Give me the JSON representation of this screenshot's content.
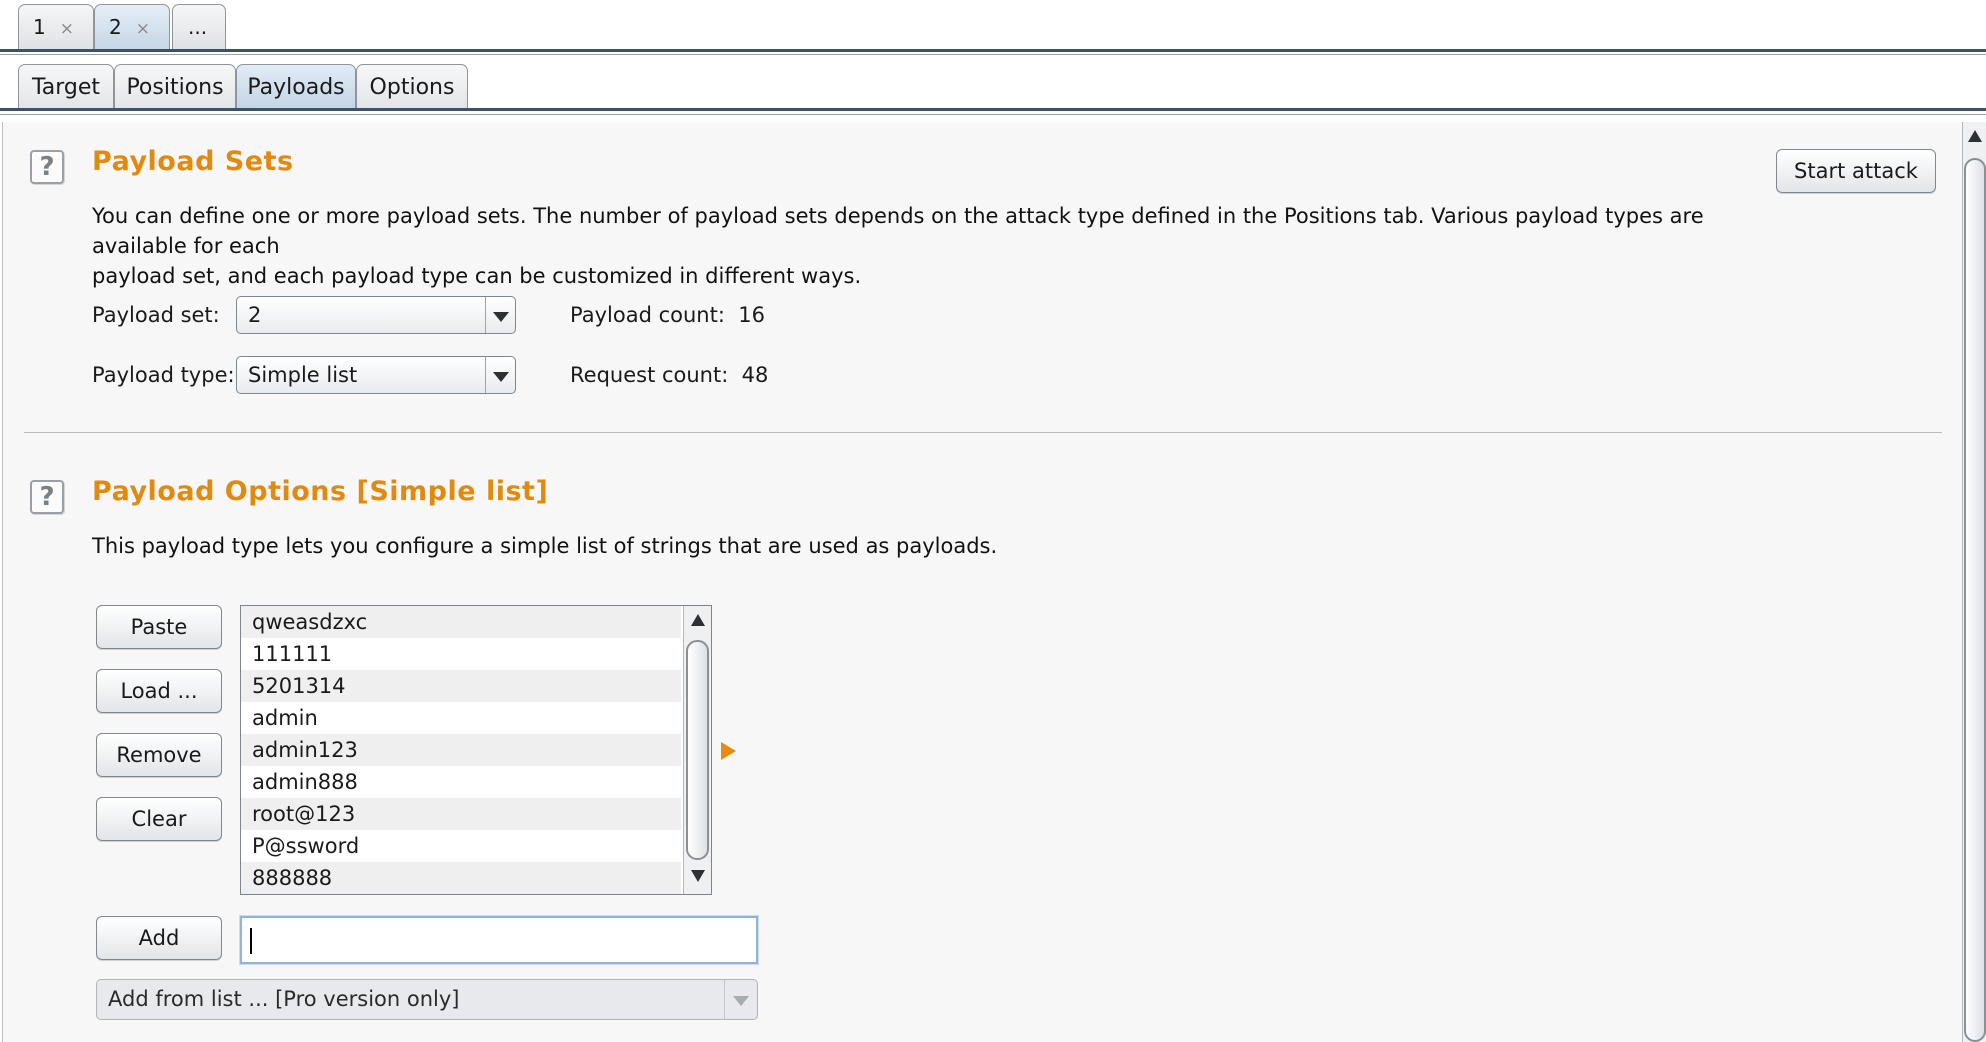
{
  "request_tabs": [
    {
      "label": "1",
      "close": "×"
    },
    {
      "label": "2",
      "close": "×"
    },
    {
      "label": "..."
    }
  ],
  "sub_tabs": [
    "Target",
    "Positions",
    "Payloads",
    "Options"
  ],
  "active_sub_tab": "Payloads",
  "payload_sets": {
    "help": "?",
    "title": "Payload Sets",
    "description_line1": "You can define one or more payload sets. The number of payload sets depends on the attack type defined in the Positions tab. Various payload types are available for each",
    "description_line2": "payload set, and each payload type can be customized in different ways.",
    "payload_set_label": "Payload set:",
    "payload_set_value": "2",
    "payload_type_label": "Payload type:",
    "payload_type_value": "Simple list",
    "payload_count_label": "Payload count:",
    "payload_count_value": "16",
    "request_count_label": "Request count:",
    "request_count_value": "48",
    "start_attack": "Start attack"
  },
  "payload_options": {
    "help": "?",
    "title": "Payload Options [Simple list]",
    "description": "This payload type lets you configure a simple list of strings that are used as payloads.",
    "buttons": {
      "paste": "Paste",
      "load": "Load ...",
      "remove": "Remove",
      "clear": "Clear",
      "add": "Add"
    },
    "list_items": [
      "qweasdzxc",
      "111111",
      "5201314",
      "admin",
      "admin123",
      "admin888",
      "root@123",
      "P@ssword",
      "888888"
    ],
    "add_input_value": "",
    "add_from_list": "Add from list ... [Pro version only]"
  },
  "colors": {
    "section_title": "#e08a10",
    "active_tab": "#c6d6e6"
  }
}
